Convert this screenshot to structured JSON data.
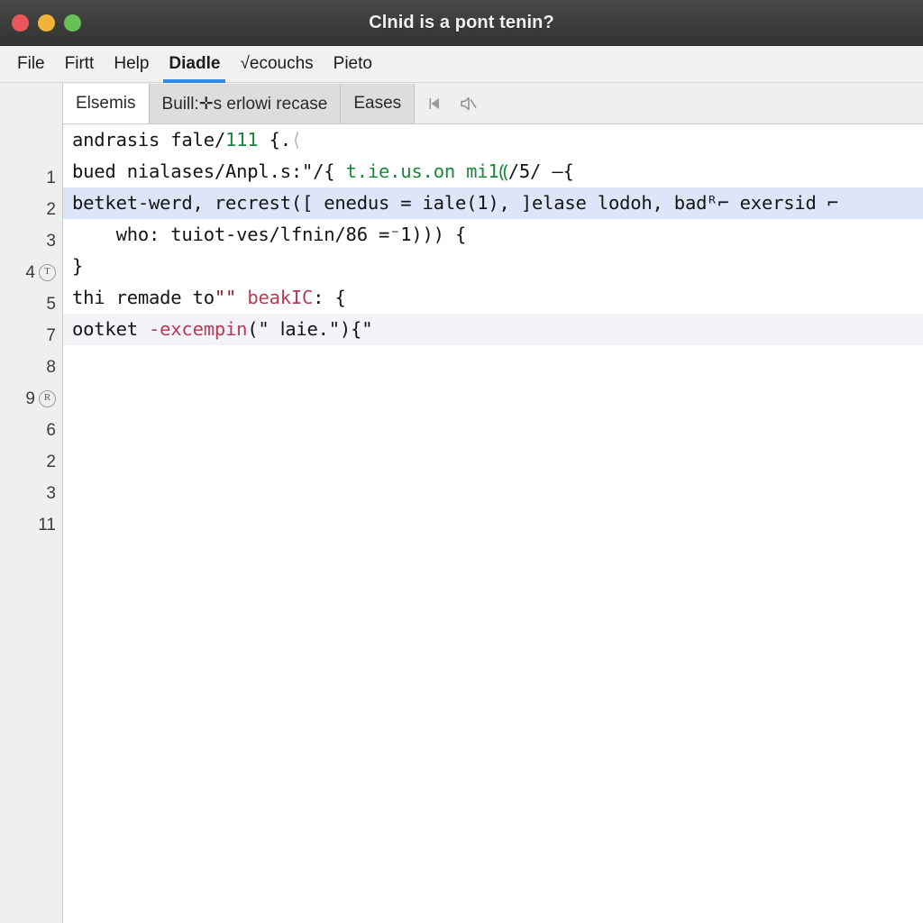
{
  "window": {
    "title": "Clnid is a pont tenin?",
    "controls": [
      {
        "name": "close",
        "color": "#e8575c"
      },
      {
        "name": "minimize",
        "color": "#f0b43c"
      },
      {
        "name": "maximize",
        "color": "#68c156"
      }
    ]
  },
  "menubar": {
    "items": [
      {
        "label": "File",
        "active": false
      },
      {
        "label": "Firtt",
        "active": false
      },
      {
        "label": "Help",
        "active": false
      },
      {
        "label": "Diadle",
        "active": true
      },
      {
        "label": "√ecouchs",
        "active": false
      },
      {
        "label": "Pieto",
        "active": false
      }
    ],
    "active_underline_color": "#2e8ae6"
  },
  "tabs": {
    "items": [
      {
        "label": "Elsemis",
        "active": true
      },
      {
        "label": "Buill:✛s erlowi recase",
        "active": false
      },
      {
        "label": "Eases",
        "active": false
      }
    ],
    "icons": [
      {
        "name": "play-back-icon"
      },
      {
        "name": "speaker-mute-icon"
      }
    ]
  },
  "gutter": {
    "rows": [
      {
        "num": "1",
        "badge": null
      },
      {
        "num": "2",
        "badge": null
      },
      {
        "num": "3",
        "badge": null
      },
      {
        "num": "4",
        "badge": "T"
      },
      {
        "num": "5",
        "badge": null
      },
      {
        "num": "7",
        "badge": null
      },
      {
        "num": "8",
        "badge": null
      },
      {
        "num": "9",
        "badge": "R"
      },
      {
        "num": "6",
        "badge": null
      },
      {
        "num": "2",
        "badge": null
      },
      {
        "num": "3",
        "badge": null
      },
      {
        "num": "11",
        "badge": null
      }
    ]
  },
  "editor": {
    "lines": [
      {
        "highlight": "none",
        "spans": [
          {
            "text": "andrasis fale/",
            "style": "plain"
          },
          {
            "text": "111",
            "style": "green"
          },
          {
            "text": " {.",
            "style": "plain"
          },
          {
            "text": "⟨",
            "style": "gray"
          }
        ]
      },
      {
        "highlight": "none",
        "spans": [
          {
            "text": "bued nialases/Anpl.s:\"/{ ",
            "style": "plain"
          },
          {
            "text": "t.ie.us.on mi1⸨",
            "style": "green"
          },
          {
            "text": "/5/ —{",
            "style": "plain"
          }
        ]
      },
      {
        "highlight": "blue",
        "spans": [
          {
            "text": "betket-werd, recrest([ enedus = iale(1), ]elase lodoh, badᴿ⌐ exersid ⌐",
            "style": "plain"
          }
        ]
      },
      {
        "highlight": "none",
        "spans": [
          {
            "text": "    who: tuiot-ves/lfnin/86 =⁻1))) {",
            "style": "plain"
          }
        ]
      },
      {
        "highlight": "none",
        "spans": [
          {
            "text": "}",
            "style": "plain"
          }
        ]
      },
      {
        "highlight": "none",
        "spans": [
          {
            "text": "thi remade to",
            "style": "plain"
          },
          {
            "text": "\"\"",
            "style": "dkred"
          },
          {
            "text": " ",
            "style": "plain"
          },
          {
            "text": "beakIC",
            "style": "red"
          },
          {
            "text": ": {",
            "style": "plain"
          }
        ]
      },
      {
        "highlight": "faint",
        "spans": [
          {
            "text": "ootket ",
            "style": "plain"
          },
          {
            "text": "-excempin",
            "style": "red"
          },
          {
            "text": "(\" ⅼaie.\"){\"",
            "style": "plain"
          }
        ]
      }
    ]
  }
}
